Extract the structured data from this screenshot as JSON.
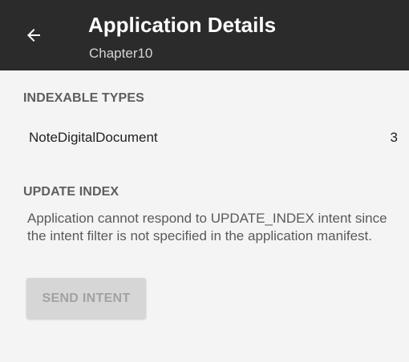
{
  "app_bar": {
    "back_icon": "arrow-left-icon",
    "title": "Application Details",
    "subtitle": "Chapter10",
    "background": "#2b2b2b"
  },
  "indexable_types": {
    "header": "INDEXABLE TYPES",
    "items": [
      {
        "label": "NoteDigitalDocument",
        "count": "3"
      }
    ]
  },
  "update_index": {
    "header": "UPDATE INDEX",
    "message": "Application cannot respond to UPDATE_INDEX intent since the intent filter is not specified in the application manifest.",
    "button_label": "SEND INTENT",
    "button_enabled": false
  }
}
